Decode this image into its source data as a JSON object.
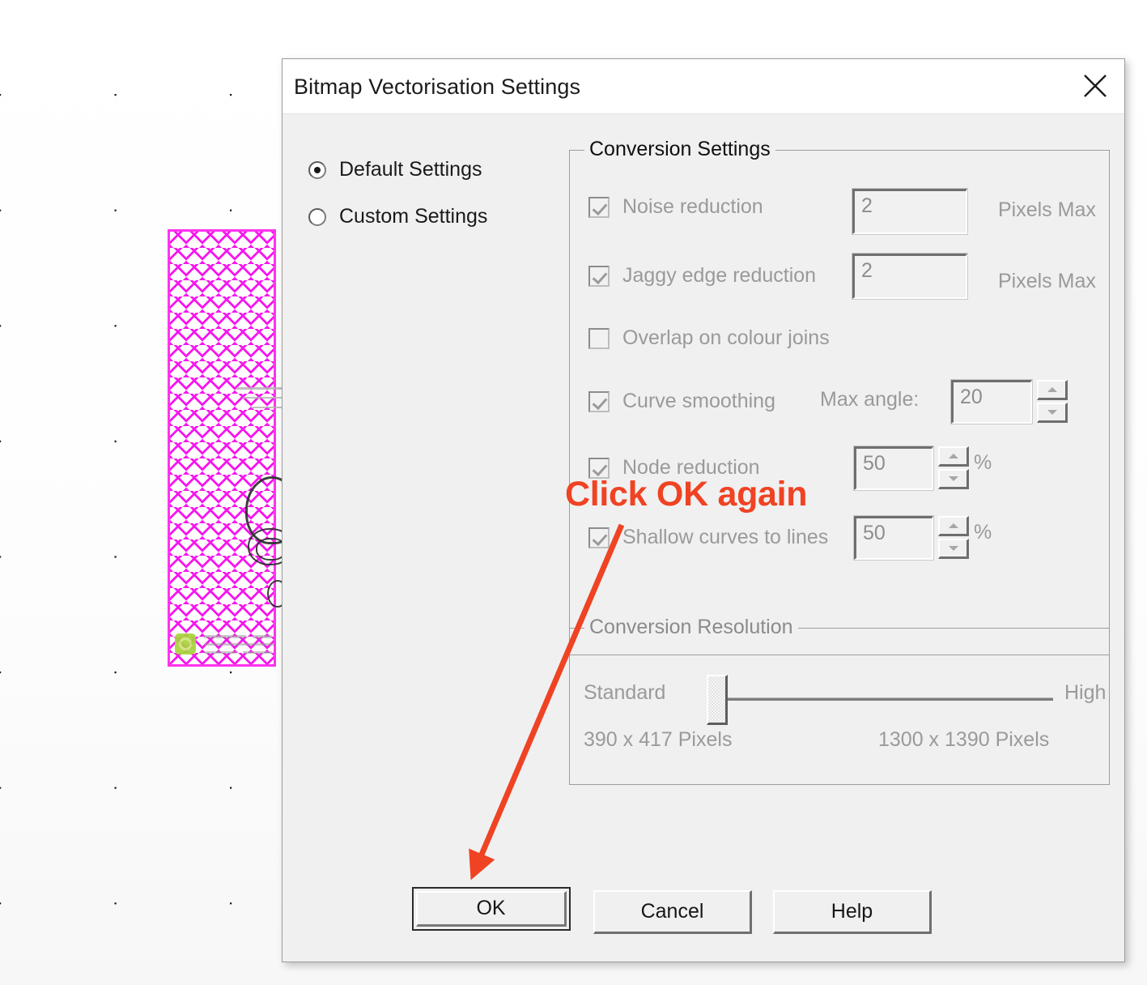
{
  "window": {
    "title": "Bitmap Vectorisation Settings",
    "close_icon": "close-icon"
  },
  "mode": {
    "options": [
      {
        "label": "Default Settings",
        "selected": true
      },
      {
        "label": "Custom Settings",
        "selected": false
      }
    ]
  },
  "conversion_settings": {
    "group_title": "Conversion Settings",
    "rows": [
      {
        "label": "Noise reduction",
        "checked": true,
        "value": "2",
        "unit": "Pixels Max"
      },
      {
        "label": "Jaggy edge reduction",
        "checked": true,
        "value": "2",
        "unit": "Pixels Max"
      },
      {
        "label": "Overlap on colour joins",
        "checked": false,
        "value": "",
        "unit": ""
      },
      {
        "label": "Curve smoothing",
        "checked": true,
        "value": "20",
        "unit": "",
        "side_label": "Max angle:"
      },
      {
        "label": "Node reduction",
        "checked": true,
        "value": "50",
        "unit": "%"
      },
      {
        "label": "Shallow curves to lines",
        "checked": true,
        "value": "50",
        "unit": "%"
      }
    ]
  },
  "conversion_resolution": {
    "group_title": "Conversion Resolution",
    "min_label": "Standard",
    "max_label": "High",
    "min_pixels": "390 x 417 Pixels",
    "max_pixels": "1300 x 1390 Pixels",
    "slider_position_percent": 2
  },
  "buttons": {
    "ok": "OK",
    "cancel": "Cancel",
    "help": "Help"
  },
  "annotation": {
    "text": "Click OK again",
    "color": "#ef4323"
  }
}
